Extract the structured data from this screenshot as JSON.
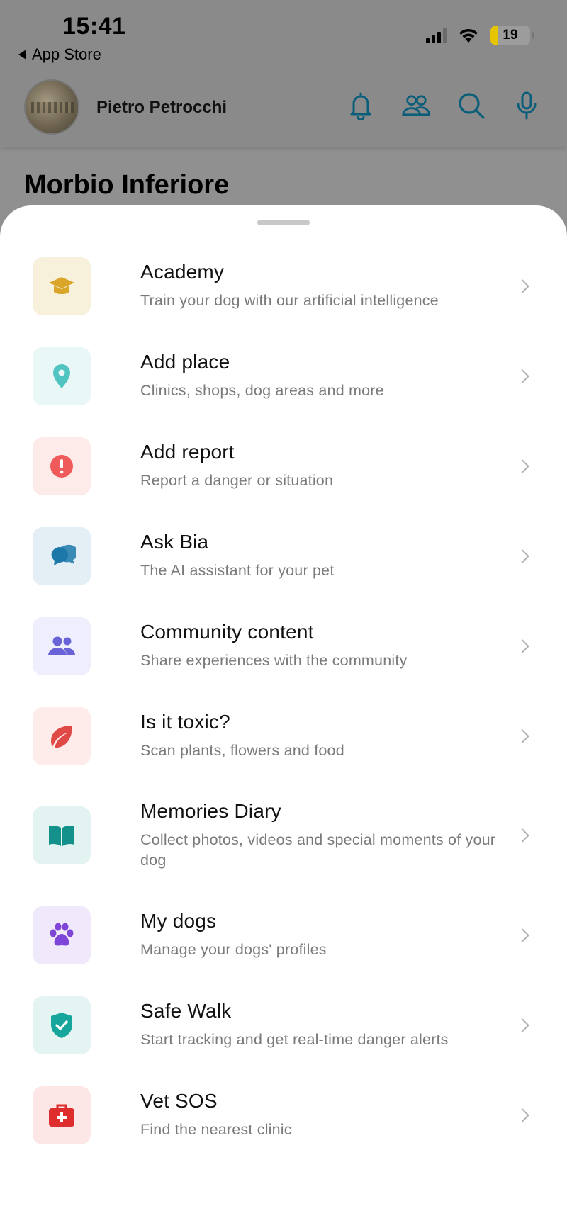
{
  "status_bar": {
    "time": "15:41",
    "back_label": "App Store",
    "battery": "19"
  },
  "header": {
    "user_name": "Pietro Petrocchi",
    "icons": [
      "bell-icon",
      "people-icon",
      "search-icon",
      "microphone-icon"
    ]
  },
  "location_title": "Morbio Inferiore",
  "menu": {
    "items": [
      {
        "title": "Academy",
        "subtitle": "Train your dog with our artificial intelligence",
        "icon": "graduation-cap-icon",
        "bg": "#f7f1dc",
        "color": "#d9a62a"
      },
      {
        "title": "Add place",
        "subtitle": "Clinics, shops, dog areas and more",
        "icon": "map-pin-icon",
        "bg": "#e9f7f7",
        "color": "#4fc4c0"
      },
      {
        "title": "Add report",
        "subtitle": "Report a danger or situation",
        "icon": "alert-icon",
        "bg": "#fdebea",
        "color": "#ef5a5a"
      },
      {
        "title": "Ask Bia",
        "subtitle": "The AI assistant for your pet",
        "icon": "chat-bubbles-icon",
        "bg": "#e4eef5",
        "color": "#1b78a8"
      },
      {
        "title": "Community content",
        "subtitle": "Share experiences with the community",
        "icon": "community-icon",
        "bg": "#eeeefc",
        "color": "#6a63d8"
      },
      {
        "title": "Is it toxic?",
        "subtitle": "Scan plants, flowers and food",
        "icon": "leaf-icon",
        "bg": "#fdecea",
        "color": "#e04a46"
      },
      {
        "title": "Memories Diary",
        "subtitle": "Collect photos, videos and special moments of your dog",
        "icon": "book-icon",
        "bg": "#e3f3f1",
        "color": "#13918a"
      },
      {
        "title": "My dogs",
        "subtitle": "Manage your dogs' profiles",
        "icon": "paw-icon",
        "bg": "#efe9fb",
        "color": "#7e45d8"
      },
      {
        "title": "Safe Walk",
        "subtitle": "Start tracking and get real-time danger alerts",
        "icon": "shield-check-icon",
        "bg": "#e3f4f2",
        "color": "#16a69b"
      },
      {
        "title": "Vet SOS",
        "subtitle": "Find the nearest clinic",
        "icon": "first-aid-kit-icon",
        "bg": "#fde6e6",
        "color": "#dd2d2d"
      }
    ]
  }
}
